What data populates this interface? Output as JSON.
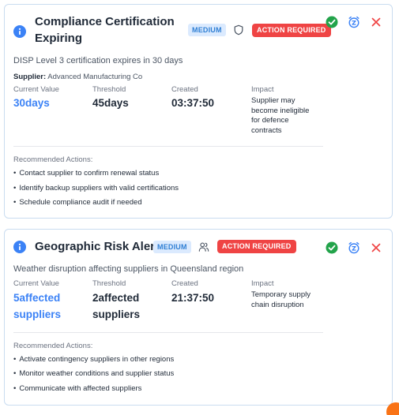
{
  "alerts": [
    {
      "title": "Compliance Certification Expiring",
      "severity": "MEDIUM",
      "type_icon": "shield-icon",
      "status": "ACTION REQUIRED",
      "description": "DISP Level 3 certification expires in 30 days",
      "supplier_label": "Supplier:",
      "supplier_name": "Advanced Manufacturing Co",
      "metrics": {
        "current_label": "Current Value",
        "current_value": "30days",
        "threshold_label": "Threshold",
        "threshold_value": "45days",
        "created_label": "Created",
        "created_value": "03:37:50",
        "impact_label": "Impact",
        "impact_lines": [
          "Supplier may",
          "become ineligible",
          "for defence",
          "contracts"
        ]
      },
      "recommended_title": "Recommended Actions:",
      "recommended": [
        "Contact supplier to confirm renewal status",
        "Identify backup suppliers with valid certifications",
        "Schedule compliance audit if needed"
      ]
    },
    {
      "title": "Geographic Risk Alert",
      "severity": "MEDIUM",
      "type_icon": "users-icon",
      "status": "ACTION REQUIRED",
      "description": "Weather disruption affecting suppliers in Queensland region",
      "metrics": {
        "current_label": "Current Value",
        "current_value_lines": [
          "5affected",
          "suppliers"
        ],
        "threshold_label": "Threshold",
        "threshold_value_lines": [
          "2affected",
          "suppliers"
        ],
        "created_label": "Created",
        "created_value": "21:37:50",
        "impact_label": "Impact",
        "impact_lines": [
          "Temporary supply",
          "chain disruption"
        ]
      },
      "recommended_title": "Recommended Actions:",
      "recommended": [
        "Activate contingency suppliers in other regions",
        "Monitor weather conditions and supplier status",
        "Communicate with affected suppliers"
      ]
    }
  ],
  "icons": {
    "info": "info-icon",
    "acknowledge": "check-circle-icon",
    "snooze": "alarm-clock-icon",
    "dismiss": "close-icon"
  },
  "colors": {
    "accent_blue": "#3b82f6",
    "danger_red": "#ef4444",
    "success_green": "#22a34a",
    "badge_bg": "#dbeafe",
    "card_border": "#c9dcf0"
  }
}
